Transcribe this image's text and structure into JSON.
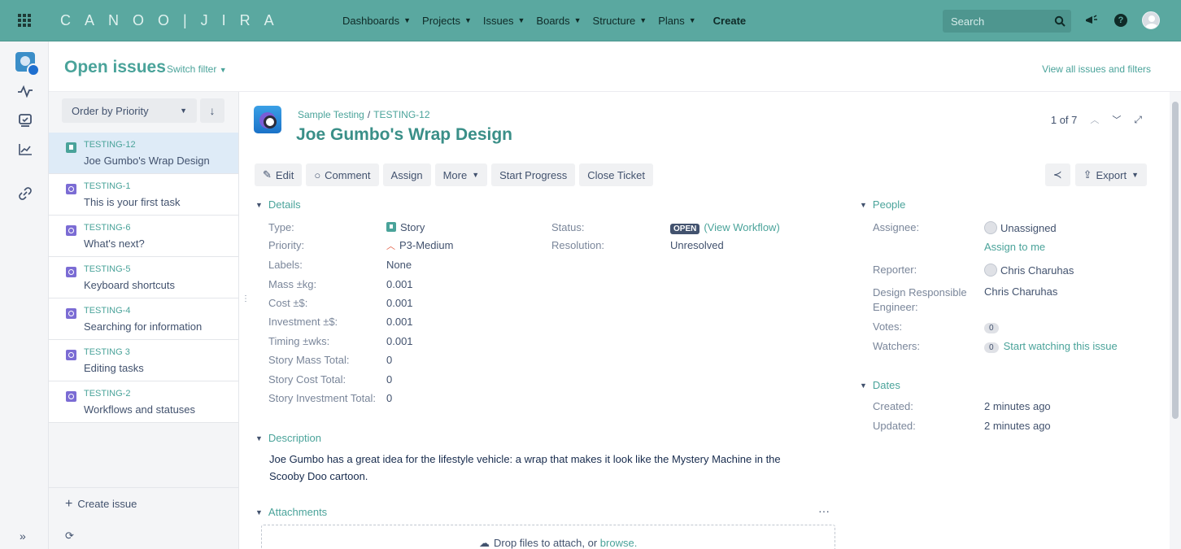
{
  "nav": {
    "logo": "CANOO|JIRA",
    "items": [
      {
        "label": "Dashboards"
      },
      {
        "label": "Projects"
      },
      {
        "label": "Issues"
      },
      {
        "label": "Boards"
      },
      {
        "label": "Structure"
      },
      {
        "label": "Plans"
      }
    ],
    "create": "Create",
    "search_placeholder": "Search"
  },
  "header": {
    "title": "Open issues",
    "switch_filter": "Switch filter",
    "view_all": "View all issues and filters"
  },
  "list": {
    "order_label": "Order by Priority",
    "sort_icon": "arrow-down-icon",
    "items": [
      {
        "key": "TESTING-12",
        "summary": "Joe Gumbo's Wrap Design",
        "type": "story"
      },
      {
        "key": "TESTING-1",
        "summary": "This is your first task",
        "type": "task"
      },
      {
        "key": "TESTING-6",
        "summary": "What's next?",
        "type": "task"
      },
      {
        "key": "TESTING-5",
        "summary": "Keyboard shortcuts",
        "type": "task"
      },
      {
        "key": "TESTING-4",
        "summary": "Searching for information",
        "type": "task"
      },
      {
        "key": "TESTING 3",
        "summary": "Editing tasks",
        "type": "task"
      },
      {
        "key": "TESTING-2",
        "summary": "Workflows and statuses",
        "type": "task"
      }
    ],
    "create_issue": "Create issue"
  },
  "issue": {
    "project": "Sample Testing",
    "key": "TESTING-12",
    "title": "Joe Gumbo's Wrap Design",
    "pager": "1 of 7",
    "actions": {
      "edit": "Edit",
      "comment": "Comment",
      "assign": "Assign",
      "more": "More",
      "start_progress": "Start Progress",
      "close_ticket": "Close Ticket",
      "export": "Export"
    },
    "details": {
      "heading": "Details",
      "fields": [
        {
          "label": "Type:",
          "value": "Story"
        },
        {
          "label": "Priority:",
          "value": "P3-Medium"
        },
        {
          "label": "Labels:",
          "value": "None"
        },
        {
          "label": "Mass ±kg:",
          "value": "0.001"
        },
        {
          "label": "Cost ±$:",
          "value": "0.001"
        },
        {
          "label": "Investment ±$:",
          "value": "0.001"
        },
        {
          "label": "Timing ±wks:",
          "value": "0.001"
        },
        {
          "label": "Story Mass Total:",
          "value": "0"
        },
        {
          "label": "Story Cost Total:",
          "value": "0"
        },
        {
          "label": "Story Investment Total:",
          "value": "0"
        }
      ],
      "status_label": "Status:",
      "status_value": "OPEN",
      "view_workflow": "(View Workflow)",
      "resolution_label": "Resolution:",
      "resolution_value": "Unresolved"
    },
    "description": {
      "heading": "Description",
      "text": "Joe Gumbo has a great idea for the lifestyle vehicle: a wrap that makes it look like the Mystery Machine in the Scooby Doo cartoon."
    },
    "attachments": {
      "heading": "Attachments",
      "drop_text": "Drop files to attach, or",
      "browse": "browse."
    },
    "people": {
      "heading": "People",
      "assignee_label": "Assignee:",
      "assignee_value": "Unassigned",
      "assign_to_me": "Assign to me",
      "reporter_label": "Reporter:",
      "reporter_value": "Chris Charuhas",
      "dre_label": "Design Responsible Engineer:",
      "dre_value": "Chris Charuhas",
      "votes_label": "Votes:",
      "votes_value": "0",
      "watchers_label": "Watchers:",
      "watchers_value": "0",
      "start_watching": "Start watching this issue"
    },
    "dates": {
      "heading": "Dates",
      "created_label": "Created:",
      "created_value": "2 minutes ago",
      "updated_label": "Updated:",
      "updated_value": "2 minutes ago"
    }
  },
  "colors": {
    "topbar": "#5aa8a0",
    "accent": "#4aa39a",
    "selected_row": "#deebf7"
  }
}
